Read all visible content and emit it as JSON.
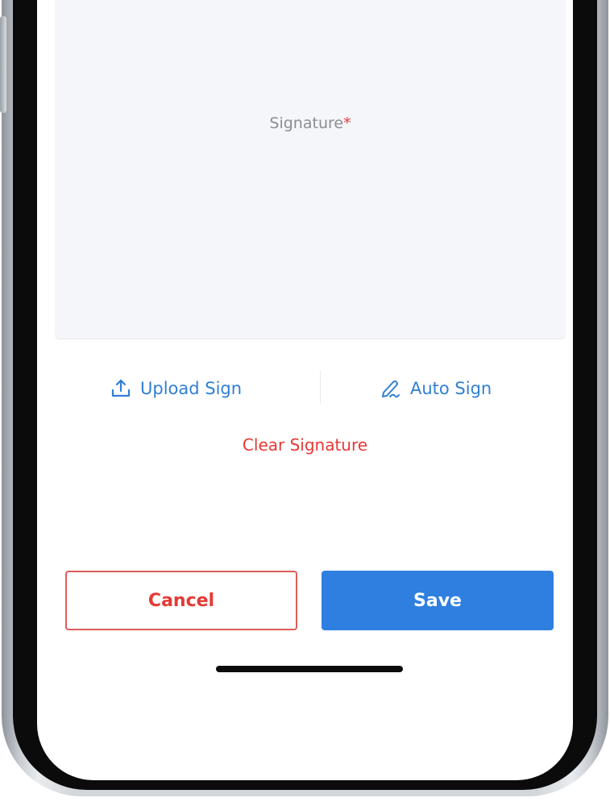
{
  "signature_pad": {
    "label": "Signature",
    "required_mark": "*"
  },
  "actions": {
    "upload_label": "Upload Sign",
    "auto_label": "Auto Sign",
    "clear_label": "Clear Signature"
  },
  "footer": {
    "cancel_label": "Cancel",
    "save_label": "Save"
  },
  "colors": {
    "accent_blue": "#2f7fe0",
    "danger_red": "#e53935",
    "pad_background": "#f4f6fa"
  },
  "icons": {
    "upload": "upload-icon",
    "auto_sign": "pen-signature-icon"
  }
}
